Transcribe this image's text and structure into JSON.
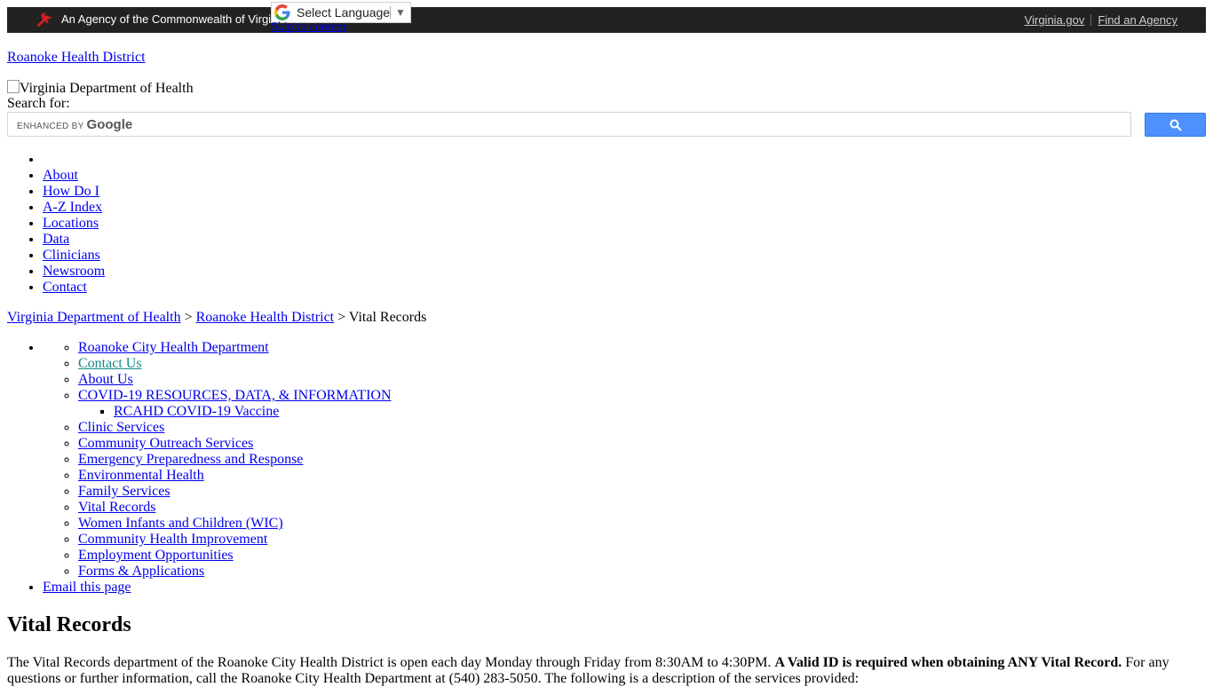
{
  "agency_bar": {
    "agency_text": "An Agency of the Commonwealth of Virginia",
    "links": [
      "Virginia.gov",
      "Find an Agency"
    ]
  },
  "translate": {
    "label": "Select Language",
    "arrow": "▼"
  },
  "skip_link": "Skip to content",
  "site_title": "Roanoke Health District",
  "logo_alt": "Virginia Department of Health",
  "search": {
    "label": "Search for:",
    "enhanced_by": "ENHANCED BY",
    "brand": "Google",
    "button_icon": "search-icon"
  },
  "main_nav": [
    "About",
    "How Do I",
    "A-Z Index",
    "Locations",
    "Data",
    "Clinicians",
    "Newsroom",
    "Contact"
  ],
  "breadcrumb": {
    "items": [
      "Virginia Department of Health",
      "Roanoke Health District"
    ],
    "separator": ">",
    "current": "Vital Records"
  },
  "side_nav": {
    "items": [
      "Roanoke City Health Department",
      "Contact Us",
      "About Us",
      "COVID-19 RESOURCES, DATA, & INFORMATION",
      "Clinic Services",
      "Community Outreach Services",
      "Emergency Preparedness and Response",
      "Environmental Health",
      "Family Services",
      "Vital Records",
      "Women Infants and Children (WIC)",
      "Community Health Improvement",
      "Employment Opportunities",
      "Forms & Applications"
    ],
    "covid_subitem": "RCAHD COVID-19 Vaccine",
    "email_page": "Email this page"
  },
  "page": {
    "heading": "Vital Records",
    "intro_part1": "The Vital Records department of the Roanoke City Health District is open each day Monday through Friday from 8:30AM to 4:30PM. ",
    "intro_bold": "A Valid ID is required when obtaining ANY Vital Record.",
    "intro_part2": " For any questions or further information, call the Roanoke City Health Department at (540) 283-5050. The following is a description of the services provided:"
  },
  "colors": {
    "agency_bar_bg": "#222222",
    "link": "#0000ee",
    "visited_link": "#0e8a8a",
    "search_button": "#4d90fe"
  }
}
